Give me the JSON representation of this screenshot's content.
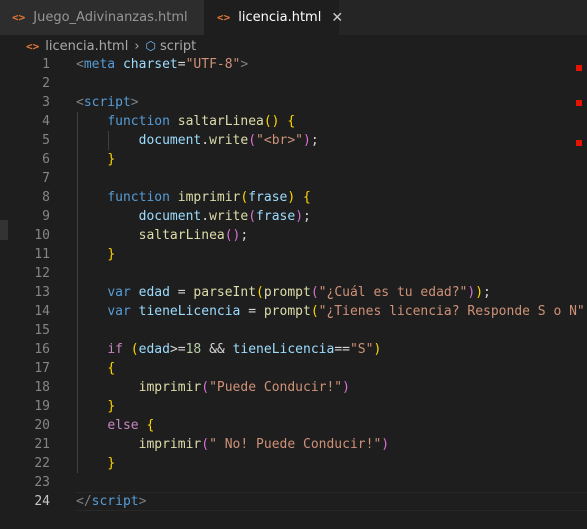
{
  "tabs": [
    {
      "icon": "html-file-icon",
      "label": "Juego_Adivinanzas.html",
      "active": false
    },
    {
      "icon": "html-file-icon",
      "label": "licencia.html",
      "active": true
    }
  ],
  "breadcrumb": {
    "file": "licencia.html",
    "symbol": "script"
  },
  "editor": {
    "current_line": 24,
    "line_numbers": [
      "1",
      "2",
      "3",
      "4",
      "5",
      "6",
      "7",
      "8",
      "9",
      "10",
      "11",
      "12",
      "13",
      "14",
      "15",
      "16",
      "17",
      "18",
      "19",
      "20",
      "21",
      "22",
      "23",
      "24"
    ],
    "lines": [
      [
        [
          "t-bracket",
          "<"
        ],
        [
          "t-tag",
          "meta"
        ],
        [
          "t-op",
          " "
        ],
        [
          "t-attr",
          "charset"
        ],
        [
          "t-op",
          "="
        ],
        [
          "t-str",
          "\"UTF-8\""
        ],
        [
          "t-bracket",
          ">"
        ]
      ],
      [],
      [
        [
          "t-bracket",
          "<"
        ],
        [
          "t-tag",
          "script"
        ],
        [
          "t-bracket",
          ">"
        ]
      ],
      [
        [
          "t-op",
          "    "
        ],
        [
          "t-kw",
          "function"
        ],
        [
          "t-op",
          " "
        ],
        [
          "t-fn",
          "saltarLinea"
        ],
        [
          "t-p1",
          "()"
        ],
        [
          "t-op",
          " "
        ],
        [
          "t-p1",
          "{"
        ]
      ],
      [
        [
          "t-op",
          "        "
        ],
        [
          "t-var",
          "document"
        ],
        [
          "t-op",
          "."
        ],
        [
          "t-fn",
          "write"
        ],
        [
          "t-p2",
          "("
        ],
        [
          "t-str",
          "\"<br>\""
        ],
        [
          "t-p2",
          ")"
        ],
        [
          "t-op",
          ";"
        ]
      ],
      [
        [
          "t-op",
          "    "
        ],
        [
          "t-p1",
          "}"
        ]
      ],
      [],
      [
        [
          "t-op",
          "    "
        ],
        [
          "t-kw",
          "function"
        ],
        [
          "t-op",
          " "
        ],
        [
          "t-fn",
          "imprimir"
        ],
        [
          "t-p1",
          "("
        ],
        [
          "t-var",
          "frase"
        ],
        [
          "t-p1",
          ")"
        ],
        [
          "t-op",
          " "
        ],
        [
          "t-p1",
          "{"
        ]
      ],
      [
        [
          "t-op",
          "        "
        ],
        [
          "t-var",
          "document"
        ],
        [
          "t-op",
          "."
        ],
        [
          "t-fn",
          "write"
        ],
        [
          "t-p2",
          "("
        ],
        [
          "t-var",
          "frase"
        ],
        [
          "t-p2",
          ")"
        ],
        [
          "t-op",
          ";"
        ]
      ],
      [
        [
          "t-op",
          "        "
        ],
        [
          "t-fn",
          "saltarLinea"
        ],
        [
          "t-p2",
          "()"
        ],
        [
          "t-op",
          ";"
        ]
      ],
      [
        [
          "t-op",
          "    "
        ],
        [
          "t-p1",
          "}"
        ]
      ],
      [],
      [
        [
          "t-op",
          "    "
        ],
        [
          "t-kw",
          "var"
        ],
        [
          "t-op",
          " "
        ],
        [
          "t-var",
          "edad"
        ],
        [
          "t-op",
          " = "
        ],
        [
          "t-fn",
          "parseInt"
        ],
        [
          "t-p1",
          "("
        ],
        [
          "t-fn",
          "prompt"
        ],
        [
          "t-p2",
          "("
        ],
        [
          "t-str",
          "\"¿Cuál es tu edad?\""
        ],
        [
          "t-p2",
          ")"
        ],
        [
          "t-p1",
          ")"
        ],
        [
          "t-op",
          ";"
        ]
      ],
      [
        [
          "t-op",
          "    "
        ],
        [
          "t-kw",
          "var"
        ],
        [
          "t-op",
          " "
        ],
        [
          "t-var",
          "tieneLicencia"
        ],
        [
          "t-op",
          " = "
        ],
        [
          "t-fn",
          "prompt"
        ],
        [
          "t-p1",
          "("
        ],
        [
          "t-str",
          "\"¿Tienes licencia? Responde S o N\""
        ]
      ],
      [],
      [
        [
          "t-op",
          "    "
        ],
        [
          "t-ctl",
          "if"
        ],
        [
          "t-op",
          " "
        ],
        [
          "t-p1",
          "("
        ],
        [
          "t-var",
          "edad"
        ],
        [
          "t-op",
          ">="
        ],
        [
          "t-num",
          "18"
        ],
        [
          "t-op",
          " && "
        ],
        [
          "t-var",
          "tieneLicencia"
        ],
        [
          "t-op",
          "=="
        ],
        [
          "t-str",
          "\"S\""
        ],
        [
          "t-p1",
          ")"
        ]
      ],
      [
        [
          "t-op",
          "    "
        ],
        [
          "t-p1",
          "{"
        ]
      ],
      [
        [
          "t-op",
          "        "
        ],
        [
          "t-fn",
          "imprimir"
        ],
        [
          "t-p2",
          "("
        ],
        [
          "t-str",
          "\"Puede Conducir!\""
        ],
        [
          "t-p2",
          ")"
        ]
      ],
      [
        [
          "t-op",
          "    "
        ],
        [
          "t-p1",
          "}"
        ]
      ],
      [
        [
          "t-op",
          "    "
        ],
        [
          "t-ctl",
          "else"
        ],
        [
          "t-op",
          " "
        ],
        [
          "t-p1",
          "{"
        ]
      ],
      [
        [
          "t-op",
          "        "
        ],
        [
          "t-fn",
          "imprimir"
        ],
        [
          "t-p2",
          "("
        ],
        [
          "t-str",
          "\" No! Puede Conducir!\""
        ],
        [
          "t-p2",
          ")"
        ]
      ],
      [
        [
          "t-op",
          "    "
        ],
        [
          "t-p1",
          "}"
        ]
      ],
      [],
      [
        [
          "t-bracket",
          "</"
        ],
        [
          "t-tag",
          "script"
        ],
        [
          "t-bracket",
          ">"
        ]
      ]
    ]
  },
  "colors": {
    "editor_bg": "#1e1e1e",
    "tab_active_bg": "#1e1e1e",
    "tab_inactive_bg": "#2d2d2d",
    "html_icon": "#e37933",
    "minimap_marker": "#e51400"
  }
}
